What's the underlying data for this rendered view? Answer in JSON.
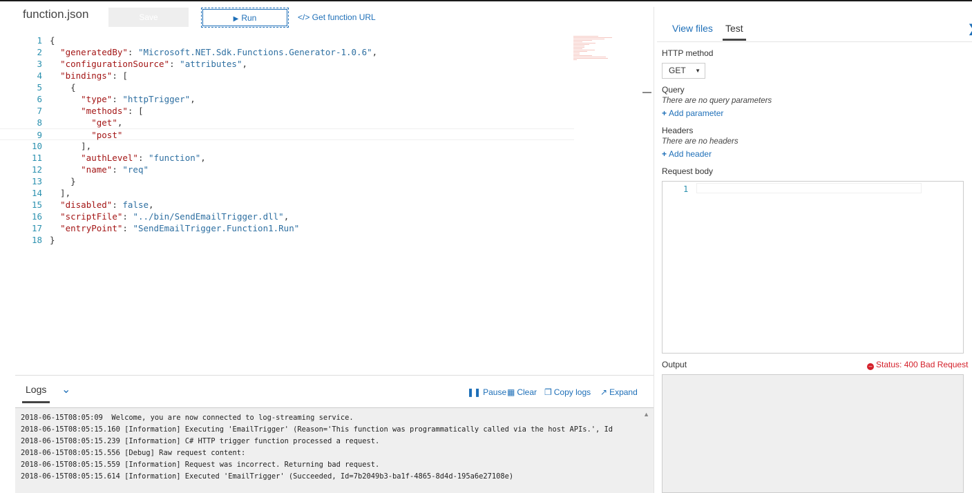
{
  "editor": {
    "file_title": "function.json",
    "save_label": "Save",
    "run_label": "Run",
    "get_url_label": "</> Get function URL",
    "lines": [
      {
        "n": "1",
        "html": "{"
      },
      {
        "n": "2",
        "html": "  <span class=\"k\">\"generatedBy\"</span>: <span class=\"s\">\"Microsoft.NET.Sdk.Functions.Generator-1.0.6\"</span>,"
      },
      {
        "n": "3",
        "html": "  <span class=\"k\">\"configurationSource\"</span>: <span class=\"s\">\"attributes\"</span>,"
      },
      {
        "n": "4",
        "html": "  <span class=\"k\">\"bindings\"</span>: ["
      },
      {
        "n": "5",
        "html": "    {"
      },
      {
        "n": "6",
        "html": "      <span class=\"k\">\"type\"</span>: <span class=\"s\">\"httpTrigger\"</span>,"
      },
      {
        "n": "7",
        "html": "      <span class=\"k\">\"methods\"</span>: ["
      },
      {
        "n": "8",
        "html": "        <span class=\"k\">\"get\"</span>,"
      },
      {
        "n": "9",
        "html": "        <span class=\"k\">\"post\"</span>"
      },
      {
        "n": "10",
        "html": "      ],"
      },
      {
        "n": "11",
        "html": "      <span class=\"k\">\"authLevel\"</span>: <span class=\"s\">\"function\"</span>,"
      },
      {
        "n": "12",
        "html": "      <span class=\"k\">\"name\"</span>: <span class=\"s\">\"req\"</span>"
      },
      {
        "n": "13",
        "html": "    }"
      },
      {
        "n": "14",
        "html": "  ],"
      },
      {
        "n": "15",
        "html": "  <span class=\"k\">\"disabled\"</span>: <span class=\"v\">false</span>,"
      },
      {
        "n": "16",
        "html": "  <span class=\"k\">\"scriptFile\"</span>: <span class=\"s\">\"../bin/SendEmailTrigger.dll\"</span>,"
      },
      {
        "n": "17",
        "html": "  <span class=\"k\">\"entryPoint\"</span>: <span class=\"s\">\"SendEmailTrigger.Function1.Run\"</span>"
      },
      {
        "n": "18",
        "html": "}"
      }
    ]
  },
  "logs": {
    "tab_label": "Logs",
    "pause_label": "Pause",
    "clear_label": "Clear",
    "copy_label": "Copy logs",
    "expand_label": "Expand",
    "lines": [
      "2018-06-15T08:05:09  Welcome, you are now connected to log-streaming service.",
      "2018-06-15T08:05:15.160 [Information] Executing 'EmailTrigger' (Reason='This function was programmatically called via the host APIs.', Id",
      "2018-06-15T08:05:15.239 [Information] C# HTTP trigger function processed a request.",
      "2018-06-15T08:05:15.556 [Debug] Raw request content:",
      "2018-06-15T08:05:15.559 [Information] Request was incorrect. Returning bad request.",
      "2018-06-15T08:05:15.614 [Information] Executed 'EmailTrigger' (Succeeded, Id=7b2049b3-ba1f-4865-8d4d-195a6e27108e)"
    ]
  },
  "test_panel": {
    "tab_view_files": "View files",
    "tab_test": "Test",
    "http_method_label": "HTTP method",
    "http_method_value": "GET",
    "query_label": "Query",
    "query_empty": "There are no query parameters",
    "add_parameter": "Add parameter",
    "headers_label": "Headers",
    "headers_empty": "There are no headers",
    "add_header": "Add header",
    "request_body_label": "Request body",
    "request_body_line": "1",
    "output_label": "Output",
    "status_text": "Status: 400 Bad Request",
    "status_color": "#d4202a"
  },
  "colors": {
    "accent": "#1e6fb8"
  }
}
